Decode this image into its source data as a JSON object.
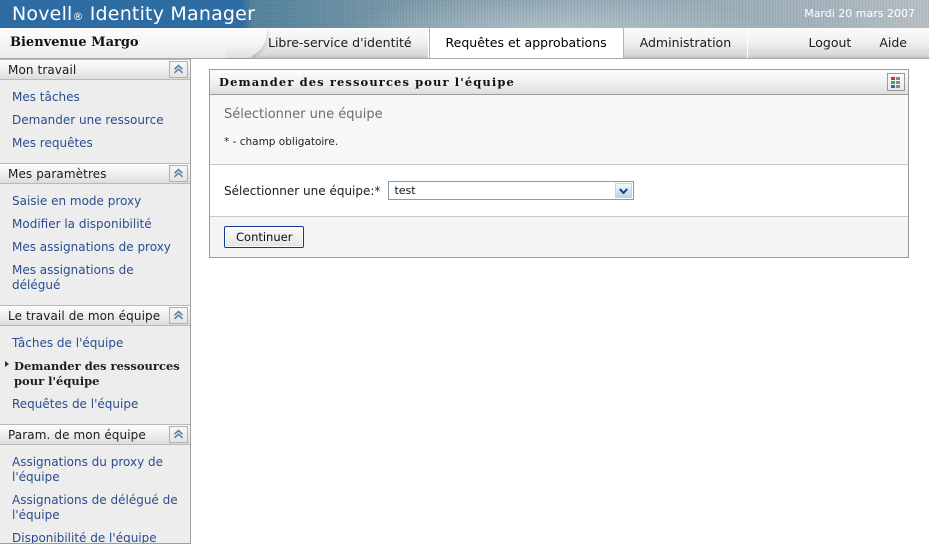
{
  "banner": {
    "brand_name": "Novell",
    "registered_mark": "®",
    "product_name": "Identity Manager",
    "date": "Mardi 20 mars 2007"
  },
  "tabbar": {
    "welcome": "Bienvenue Margo",
    "tabs": [
      {
        "label": "Libre-service d'identité",
        "active": false
      },
      {
        "label": "Requêtes et approbations",
        "active": true
      },
      {
        "label": "Administration",
        "active": false
      }
    ],
    "logout_label": "Logout",
    "help_label": "Aide"
  },
  "sidebar": {
    "sections": [
      {
        "title": "Mon travail",
        "collapse_icon": "chevron-double-up-icon",
        "items": [
          {
            "label": "Mes tâches",
            "current": false
          },
          {
            "label": "Demander une ressource",
            "current": false
          },
          {
            "label": "Mes requêtes",
            "current": false
          }
        ]
      },
      {
        "title": "Mes paramètres",
        "collapse_icon": "chevron-double-up-icon",
        "items": [
          {
            "label": "Saisie en mode proxy",
            "current": false
          },
          {
            "label": "Modifier la disponibilité",
            "current": false
          },
          {
            "label": "Mes assignations de proxy",
            "current": false
          },
          {
            "label": "Mes assignations de délégué",
            "current": false
          }
        ]
      },
      {
        "title": "Le travail de mon équipe",
        "collapse_icon": "chevron-double-up-icon",
        "items": [
          {
            "label": "Tâches de l'équipe",
            "current": false
          },
          {
            "label": "Demander des ressources pour l'équipe",
            "current": true
          },
          {
            "label": "Requêtes de l'équipe",
            "current": false
          }
        ]
      },
      {
        "title": "Param. de mon équipe",
        "collapse_icon": "chevron-double-up-icon",
        "items": [
          {
            "label": "Assignations du proxy de l'équipe",
            "current": false
          },
          {
            "label": "Assignations de délégué de l'équipe",
            "current": false
          },
          {
            "label": "Disponibilité de l'équipe",
            "current": false
          }
        ]
      }
    ]
  },
  "panel": {
    "title": "Demander des ressources pour l'équipe",
    "header_icon": "color-grid-icon",
    "info_heading": "Sélectionner une équipe",
    "required_note": "* - champ obligatoire.",
    "form": {
      "label": "Sélectionner une équipe:*",
      "select_name": "team-select",
      "selected_value": "test",
      "dropdown_icon": "chevron-down-icon"
    },
    "continue_label": "Continuer"
  },
  "colors": {
    "banner_blue": "#2e6ca4",
    "link_blue": "#2a4d8f",
    "button_border_blue": "#12388f",
    "select_border": "#7f9db9",
    "icon_red": "#d42b2b",
    "icon_green": "#2fb82f",
    "icon_blue": "#2b5fd4",
    "icon_gray": "#8a8a8a"
  }
}
